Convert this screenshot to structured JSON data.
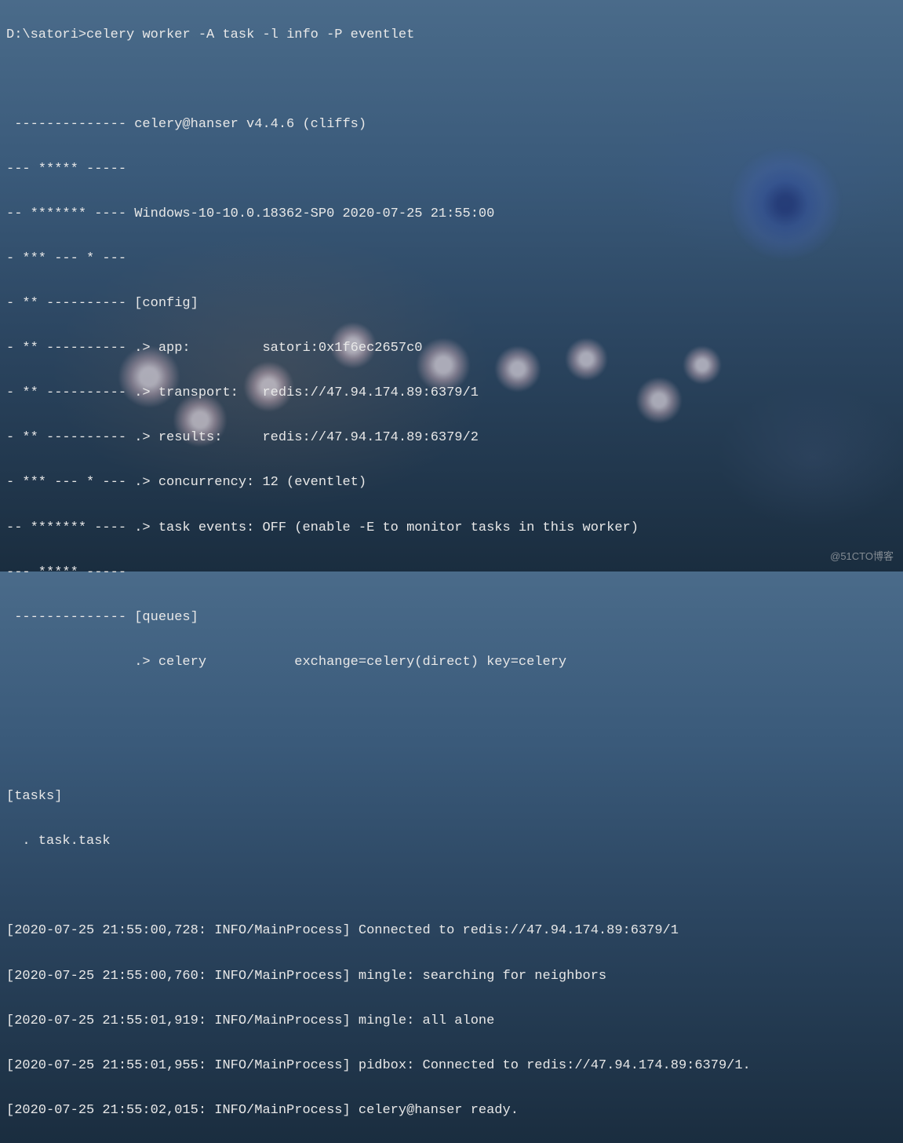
{
  "prompt": {
    "path": "D:\\satori>",
    "command": "celery worker -A task -l info -P eventlet"
  },
  "banner": {
    "l1": "",
    "l2": " -------------- celery@hanser v4.4.6 (cliffs)",
    "l3": "--- ***** -----",
    "l4": "-- ******* ---- Windows-10-10.0.18362-SP0 2020-07-25 21:55:00",
    "l5": "- *** --- * ---",
    "l6": "- ** ---------- [config]",
    "l7": "- ** ---------- .> app:         satori:0x1f6ec2657c0",
    "l8": "- ** ---------- .> transport:   redis://47.94.174.89:6379/1",
    "l9": "- ** ---------- .> results:     redis://47.94.174.89:6379/2",
    "l10": "- *** --- * --- .> concurrency: 12 (eventlet)",
    "l11": "-- ******* ---- .> task events: OFF (enable -E to monitor tasks in this worker)",
    "l12": "--- ***** -----",
    "l13": " -------------- [queues]",
    "l14": "                .> celery           exchange=celery(direct) key=celery",
    "l15": "",
    "l16": "",
    "l17": "[tasks]",
    "l18": "  . task.task",
    "l19": ""
  },
  "logs": {
    "l1": "[2020-07-25 21:55:00,728: INFO/MainProcess] Connected to redis://47.94.174.89:6379/1",
    "l2": "[2020-07-25 21:55:00,760: INFO/MainProcess] mingle: searching for neighbors",
    "l3": "[2020-07-25 21:55:01,919: INFO/MainProcess] mingle: all alone",
    "l4": "[2020-07-25 21:55:01,955: INFO/MainProcess] pidbox: Connected to redis://47.94.174.89:6379/1.",
    "l5": "[2020-07-25 21:55:02,015: INFO/MainProcess] celery@hanser ready."
  },
  "watermark": "@51CTO博客"
}
